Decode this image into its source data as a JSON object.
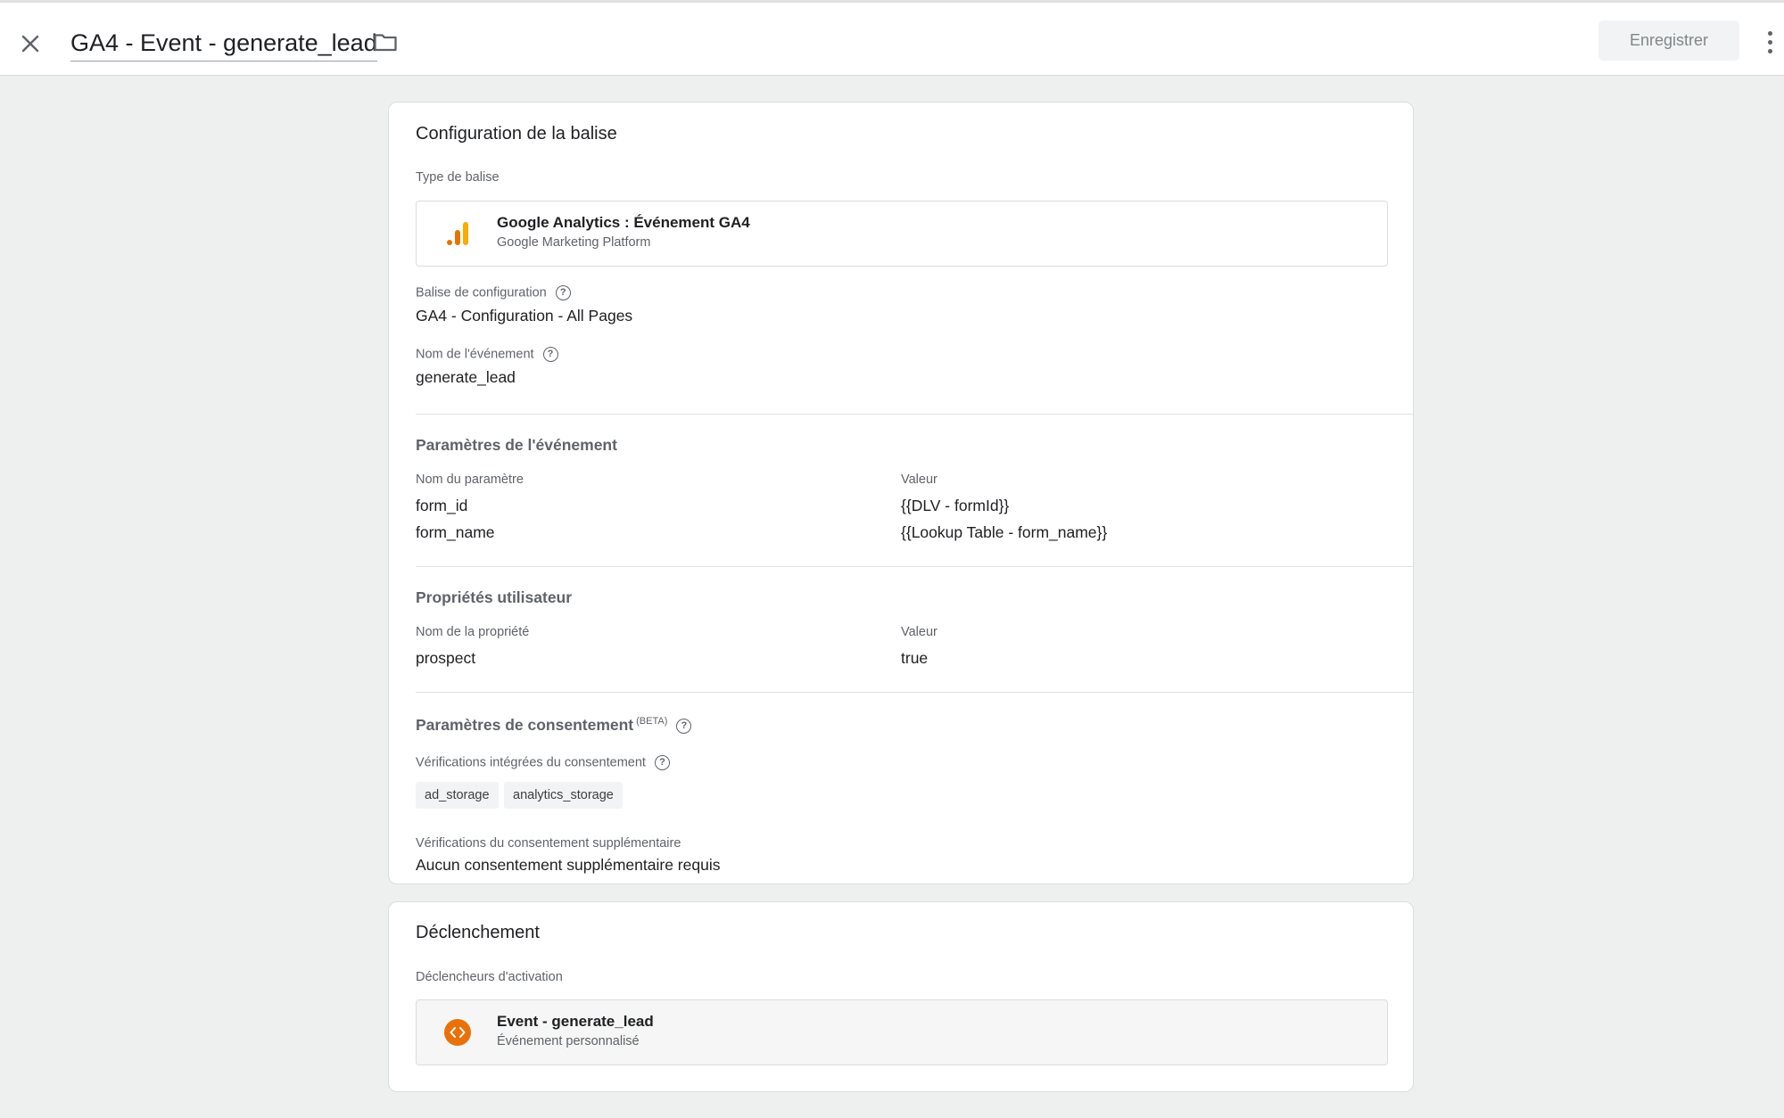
{
  "header": {
    "tag_name": "GA4 - Event - generate_lead",
    "save_label": "Enregistrer"
  },
  "tag_config": {
    "title": "Configuration de la balise",
    "tag_type_label": "Type de balise",
    "tag_type": {
      "name": "Google Analytics : Événement GA4",
      "platform": "Google Marketing Platform",
      "icon": "google-analytics-icon"
    },
    "config_tag_label": "Balise de configuration",
    "config_tag_value": "GA4 - Configuration - All Pages",
    "event_name_label": "Nom de l'événement",
    "event_name_value": "generate_lead",
    "event_params": {
      "title": "Paramètres de l'événement",
      "name_header": "Nom du paramètre",
      "value_header": "Valeur",
      "rows": [
        {
          "name": "form_id",
          "value": "{{DLV - formId}}"
        },
        {
          "name": "form_name",
          "value": "{{Lookup Table - form_name}}"
        }
      ]
    },
    "user_props": {
      "title": "Propriétés utilisateur",
      "name_header": "Nom de la propriété",
      "value_header": "Valeur",
      "rows": [
        {
          "name": "prospect",
          "value": "true"
        }
      ]
    },
    "consent": {
      "title": "Paramètres de consentement",
      "beta": "(BETA)",
      "builtin_label": "Vérifications intégrées du consentement",
      "chips": [
        "ad_storage",
        "analytics_storage"
      ],
      "additional_label": "Vérifications du consentement supplémentaire",
      "additional_value": "Aucun consentement supplémentaire requis"
    }
  },
  "triggering": {
    "title": "Déclenchement",
    "firing_label": "Déclencheurs d'activation",
    "trigger": {
      "name": "Event - generate_lead",
      "type": "Événement personnalisé",
      "icon": "custom-event-icon"
    }
  },
  "colors": {
    "ga_orange": "#F9AB00",
    "ga_dark_orange": "#E37400",
    "trigger_orange": "#E8710A"
  }
}
